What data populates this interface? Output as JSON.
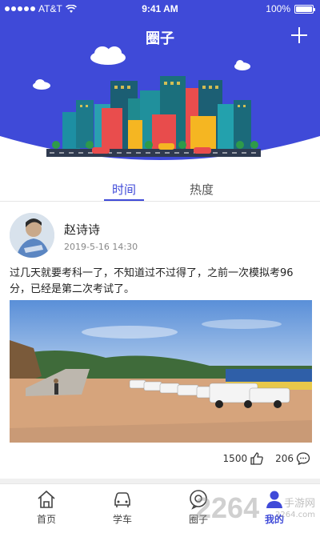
{
  "status_bar": {
    "carrier": "AT&T",
    "time": "9:41 AM",
    "battery": "100%"
  },
  "header": {
    "title": "圈子"
  },
  "tabs": [
    {
      "label": "时间",
      "active": true
    },
    {
      "label": "热度",
      "active": false
    }
  ],
  "post": {
    "author": "赵诗诗",
    "time": "2019-5-16 14:30",
    "text": "过几天就要考科一了，不知道过不过得了，之前一次模拟考96分，已经是第二次考试了。",
    "likes": "1500",
    "comments": "206"
  },
  "bottom_nav": [
    {
      "label": "首页",
      "icon": "home-icon",
      "active": false
    },
    {
      "label": "学车",
      "icon": "car-icon",
      "active": false
    },
    {
      "label": "圈子",
      "icon": "chat-circle-icon",
      "active": false
    },
    {
      "label": "我的",
      "icon": "profile-icon",
      "active": true
    }
  ],
  "watermark": {
    "main": "2264",
    "sub": "手游网",
    "domain": "2264.com"
  },
  "colors": {
    "brand": "#3f4ad8",
    "text": "#222222",
    "muted": "#888888"
  }
}
